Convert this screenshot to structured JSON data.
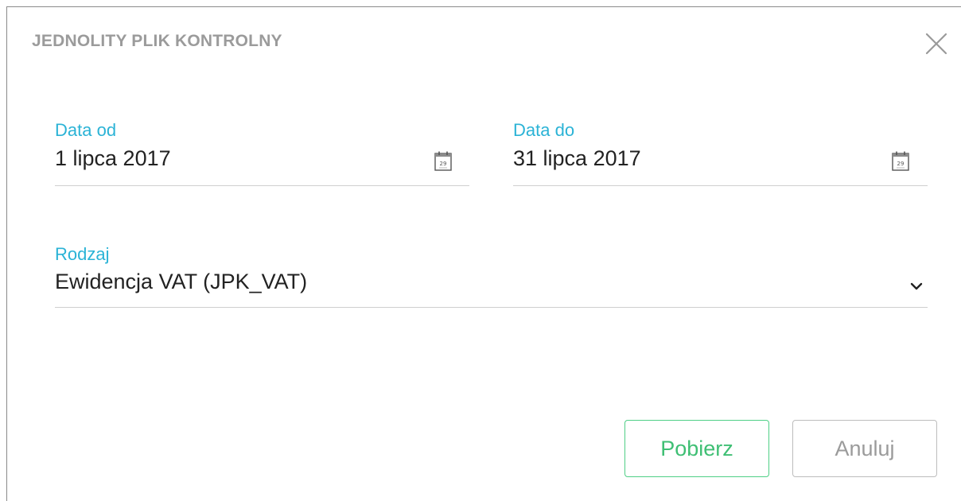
{
  "dialog": {
    "title": "JEDNOLITY PLIK KONTROLNY",
    "close_icon": "close-icon"
  },
  "form": {
    "date_from": {
      "label": "Data od",
      "value": "1 lipca 2017",
      "icon": "calendar-icon"
    },
    "date_to": {
      "label": "Data do",
      "value": "31 lipca 2017",
      "icon": "calendar-icon"
    },
    "type": {
      "label": "Rodzaj",
      "value": "Ewidencja VAT (JPK_VAT)",
      "icon": "chevron-down-icon"
    }
  },
  "actions": {
    "download_label": "Pobierz",
    "cancel_label": "Anuluj"
  },
  "colors": {
    "label_accent": "#2bb3d6",
    "primary_button": "#3fbf74",
    "title_gray": "#9b9b9b"
  }
}
